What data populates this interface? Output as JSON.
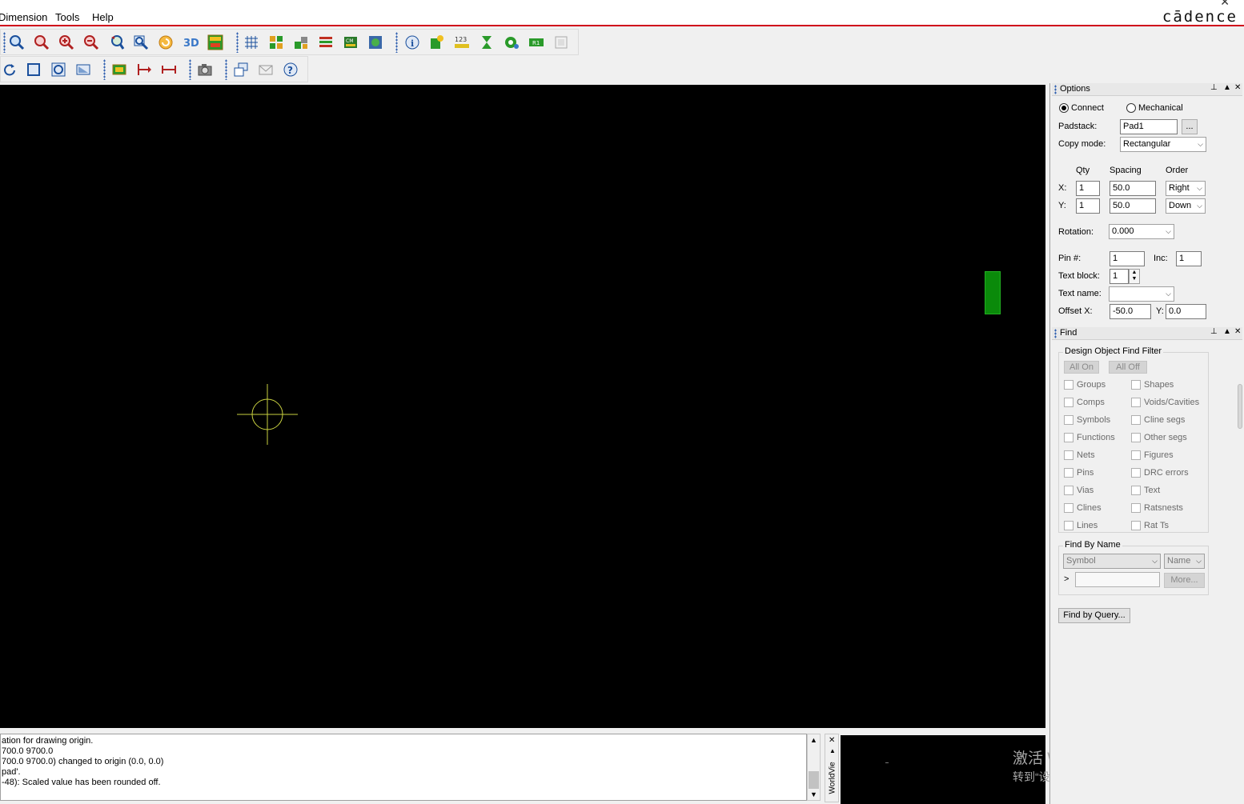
{
  "menu": {
    "items": [
      {
        "label": "Dimension",
        "hotkey_index": 0
      },
      {
        "label": "Tools",
        "hotkey_index": 0
      },
      {
        "label": "Help",
        "hotkey_index": 0
      }
    ],
    "brand": "cādence",
    "window_close": "✕"
  },
  "toolbar_top_icons": [
    "zoom-points-icon",
    "zoom-fit-icon",
    "zoom-in-icon",
    "zoom-out-icon",
    "zoom-previous-icon",
    "zoom-world-icon",
    "redraw-icon",
    "3d-view-icon",
    "flip-design-icon",
    "grid-icon",
    "color-icon",
    "layer-icon",
    "stackup-icon",
    "cm-icon",
    "visibility-icon",
    "info-icon",
    "report-icon",
    "pin-number-icon",
    "hourglass-icon",
    "add-via-icon",
    "r1-label-icon",
    "pad-stack-icon"
  ],
  "toolbar_second_icons": [
    "rotate-icon",
    "square-icon",
    "circle-icon",
    "shape-icon",
    "pad-icon",
    "dimension-icon",
    "measure-icon",
    "camera-icon",
    "layers-stack-icon",
    "mail-icon",
    "help-icon"
  ],
  "command": {
    "lines": [
      "ation for drawing origin.",
      "700.0 9700.0",
      " 700.0 9700.0) changed to origin (0.0, 0.0)",
      "pad'.",
      "-48): Scaled value has been rounded off."
    ]
  },
  "worldview": {
    "tab_label": "WorldVie"
  },
  "watermark": {
    "line1": "激活 Windows",
    "line2": "转到“设置”以激活 Windows。"
  },
  "options": {
    "title": "Options",
    "radio_connect": "Connect",
    "radio_mechanical": "Mechanical",
    "padstack_label": "Padstack:",
    "padstack_value": "Pad1",
    "browse_label": "...",
    "copy_mode_label": "Copy mode:",
    "copy_mode_value": "Rectangular",
    "col_qty": "Qty",
    "col_spacing": "Spacing",
    "col_order": "Order",
    "x_label": "X:",
    "y_label": "Y:",
    "x_qty": "1",
    "x_spacing": "50.0",
    "x_order": "Right",
    "y_qty": "1",
    "y_spacing": "50.0",
    "y_order": "Down",
    "rotation_label": "Rotation:",
    "rotation_value": "0.000",
    "pin_label": "Pin #:",
    "pin_value": "1",
    "inc_label": "Inc:",
    "inc_value": "1",
    "text_block_label": "Text block:",
    "text_block_value": "1",
    "text_name_label": "Text name:",
    "text_name_value": "",
    "offset_x_label": "Offset X:",
    "offset_x_value": "-50.0",
    "offset_y_label": "Y:",
    "offset_y_value": "0.0"
  },
  "find": {
    "title": "Find",
    "filter_title": "Design Object Find Filter",
    "all_on": "All On",
    "all_off": "All Off",
    "left_items": [
      "Groups",
      "Comps",
      "Symbols",
      "Functions",
      "Nets",
      "Pins",
      "Vias",
      "Clines",
      "Lines"
    ],
    "right_items": [
      "Shapes",
      "Voids/Cavities",
      "Cline segs",
      "Other segs",
      "Figures",
      "DRC errors",
      "Text",
      "Ratsnests",
      "Rat Ts"
    ],
    "by_name_title": "Find By Name",
    "by_name_type": "Symbol",
    "by_name_field": "Name",
    "prompt": ">",
    "name_input": "",
    "more_button": "More...",
    "query_button": "Find by Query..."
  }
}
